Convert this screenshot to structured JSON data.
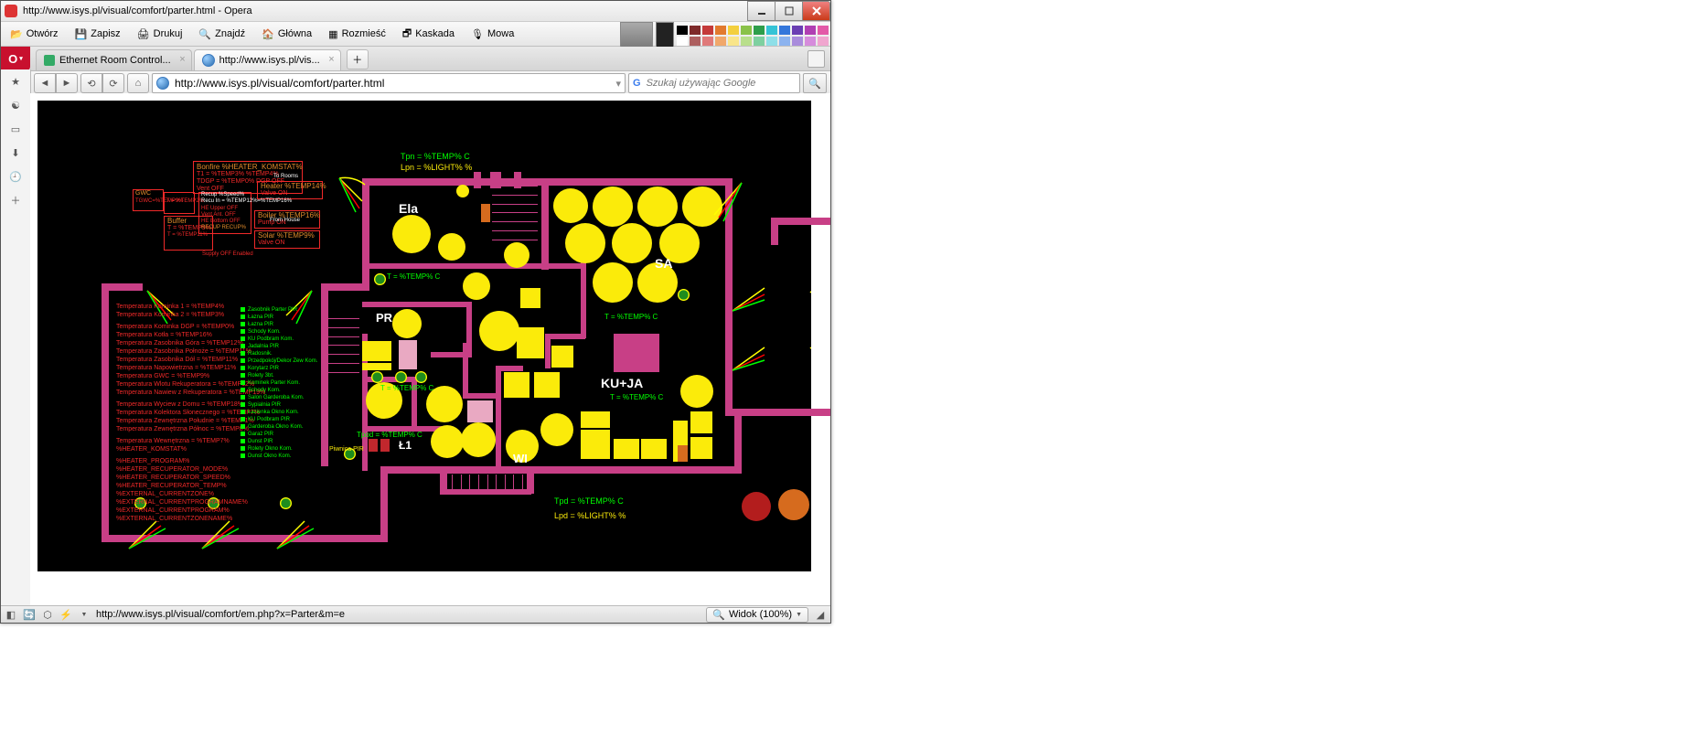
{
  "window": {
    "title": "http://www.isys.pl/visual/comfort/parter.html - Opera"
  },
  "toolbar": {
    "open": "Otwórz",
    "save": "Zapisz",
    "print": "Drukuj",
    "find": "Znajdź",
    "home": "Główna",
    "tile": "Rozmieść",
    "cascade": "Kaskada",
    "speech": "Mowa"
  },
  "tabs": {
    "t1": "Ethernet Room Control...",
    "t2": "http://www.isys.pl/vis..."
  },
  "address": {
    "url": "http://www.isys.pl/visual/comfort/parter.html",
    "search_placeholder": "Szukaj używając Google"
  },
  "colors": {
    "toolbar_swatches": [
      [
        "#000000",
        "#444444",
        "#888888",
        "#cccccc",
        "#ffffff",
        "#6b1a1a",
        "#d42626",
        "#f08030",
        "#f7d038",
        "#88c43f",
        "#2e9e4b",
        "#35c3d6",
        "#3477db",
        "#6b3fb3",
        "#b03fb3",
        "#e35aa8"
      ]
    ]
  },
  "status": {
    "url": "http://www.isys.pl/visual/comfort/em.php?x=Parter&m=e",
    "zoom": "Widok (100%)"
  },
  "plan": {
    "rooms": {
      "ela": "Ela",
      "pr": "PR",
      "sa": "SA",
      "kuja": "KU+JA",
      "wi": "WI",
      "l1": "Ł1"
    },
    "outside": {
      "tpn": "Tpn = %TEMP% C",
      "lpn": "Lpn = %LIGHT% %",
      "tpd": "Tpd = %TEMP% C",
      "lpd": "Lpd = %LIGHT% %"
    },
    "room_status": {
      "ela": "T = %TEMP% C",
      "sa": "T = %TEMP% C",
      "kuja": "T = %TEMP% C",
      "pr": "T = %TEMP% C",
      "tpod": "Tpod = %TEMP% C"
    },
    "misc_labels": {
      "piwnica_pir": "Piwnica PIR",
      "to_rooms": "To Rooms",
      "from_house": "From House"
    },
    "legend": {
      "l1": "Temperatura Kominka 1 = %TEMP4%",
      "l2": "Temperatura Kominka 2 = %TEMP3%",
      "l3": "Temperatura Kominka DGP = %TEMP0%",
      "l4": "Temperatura Kotła = %TEMP16%",
      "l5": "Temperatura Zasobnika Góra = %TEMP12%",
      "l6": "Temperatura Zasobnika Połnoże = %TEMP11%",
      "l7": "Temperatura Zasobnika Dół = %TEMP11%",
      "l8": "Temperatura Napowietrzna = %TEMP11%",
      "l9": "Temperatura GWC = %TEMP9%",
      "l10": "Temperatura Wlotu Rekuperatora = %TEMP12%",
      "l11": "Temperatura Nawiew z Rekuperatora = %TEMP19%",
      "l12": "Temperatura Wyciew z Domu = %TEMP18%",
      "l13": "Temperatura Kolektora Słonecznego = %TEMP7%",
      "l14": "Temperatura Zewnętrzna Południe = %TEMP1%",
      "l15": "Temperatura Zewnętrzna Północ = %TEMP8%",
      "l16": "Temperatura Wewnętrzna = %TEMP7%",
      "l17": "%HEATER_KOMSTAT%",
      "l18": "%HEATER_PROGRAM%",
      "l19": "%HEATER_RECUPERATOR_MODE%",
      "l20": "%HEATER_RECUPERATOR_SPEED%",
      "l21": "%HEATER_RECUPERATOR_TEMP%",
      "l22": "%EXTERNAL_CURRENTZONE%",
      "l23": "%EXTERNAL_CURRENTPROGRAMNAME%",
      "l24": "%EXTERNAL_CURRENTPROGRAM%",
      "l25": "%EXTERNAL_CURRENTZONENAME%"
    },
    "sensor_list": {
      "s1": "Zasobnik Parter PIR",
      "s2": "Łazna PIR",
      "s3": "Łazna PIR",
      "s4": "Schody Kom.",
      "s5": "KU Podbram Kom.",
      "s6": "Jadalnia PIR",
      "s7": "Radosnik.",
      "s8": "Przedpokój/Dekor Zew Kom.",
      "s9": "Korytarz PIR",
      "s10": "Rolety 3bt.",
      "s11": "Kominek Parter Kom.",
      "s12": "Schody Kom.",
      "s13": "Salon Garderoba Kom.",
      "s14": "Sypialnia PIR",
      "s15": "Łazienka Okno Kom.",
      "s16": "KU Podbram PIR",
      "s17": "Garderoba Okno Kom.",
      "s18": "Garaż PIR",
      "s19": "Dunst PIR",
      "s20": "Rolety Okno Kom.",
      "s21": "Dunst Okno Kom."
    },
    "panels": {
      "bonfire": {
        "title": "Bonfire %HEATER_KOMSTAT%",
        "l1": "T1 = %TEMP3% %TEMP4%",
        "l2": "TDGP = %TEMP0% DGP OFF",
        "l3": "Vent OFF"
      },
      "heater": {
        "title": "Heater %TEMP14%",
        "l1": "Valve ON"
      },
      "boiler": {
        "title": "Boiler %TEMP16%",
        "l1": "Pump ON"
      },
      "solar": {
        "title": "Solar %TEMP9%",
        "l1": "Valve ON"
      },
      "buffer": {
        "title": "Buffer",
        "l1": "T = %TEMP9%",
        "l2": "T = %TEMP11%",
        "l3": "Supply OFF Enabled"
      },
      "gwc": {
        "title": "GWC",
        "l1": "TGWC=%TEMP9%"
      },
      "house_rec": {
        "l1": "Recup %Speed%",
        "l2": "Recu In = %TEMP12%=%TEMP16%",
        "l3": "HE Upper OFF",
        "l4": "Vent Ant. OFF",
        "l5": "HE Bottom OFF",
        "l6": "RECUP RECUP%"
      },
      "temp2": {
        "l1": "T = %TEMP2%"
      }
    }
  }
}
